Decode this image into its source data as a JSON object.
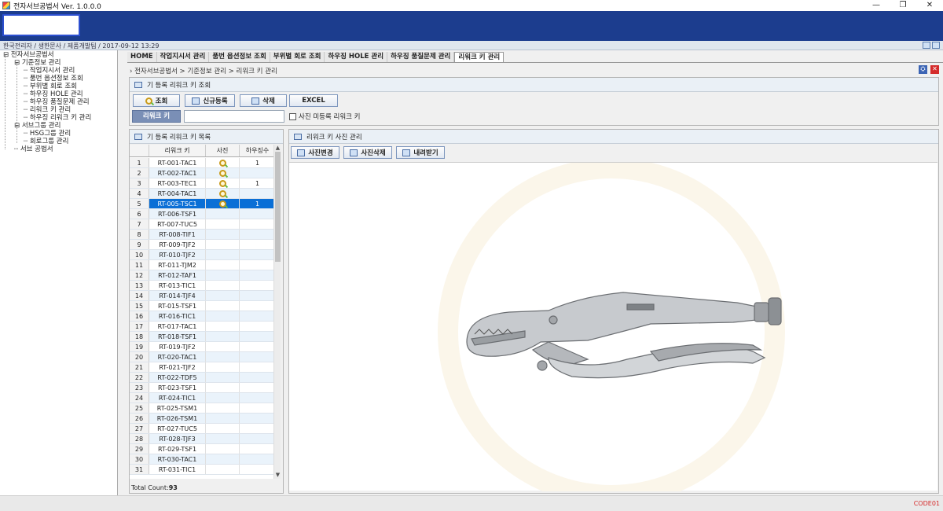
{
  "window": {
    "title": "전자서브공법서 Ver. 1.0.0.0",
    "controls": [
      "—",
      "❐",
      "✕"
    ]
  },
  "status": {
    "text": "한국전리자 / 생한문사 / 제품개발팀 / 2017-09-12 13:29"
  },
  "tree": {
    "root": "전자서브공법서",
    "groups": [
      {
        "label": "기준정보 관리",
        "items": [
          "작업지시서 관리",
          "품번 옵션정보 조회",
          "부위별 회로 조회",
          "하우징 HOLE 관리",
          "하우징 품질문제 관리",
          "리워크 키 관리",
          "하우징 리워크 키 관리"
        ]
      },
      {
        "label": "서브그룹 관리",
        "items": [
          "HSG그룹 관리",
          "회로그룹 관리"
        ]
      }
    ],
    "extra": "서브 공법서"
  },
  "tabs": [
    "HOME",
    "작업지시서 관리",
    "품번 옵션정보 조회",
    "부위별 회로 조회",
    "하우징 HOLE 관리",
    "하우징 품질문제 관리",
    "리워크 키 관리"
  ],
  "active_tab_index": 6,
  "breadcrumb": "전자서브공법서 > 기준정보 관리 > 리워크 키 관리",
  "search_panel": {
    "title": "기 등록 리워크 키 조회",
    "buttons": {
      "search": "조회",
      "new": "신규등록",
      "delete": "삭제",
      "excel": "EXCEL"
    },
    "key_label": "리워크 키",
    "key_value": "",
    "checkbox_label": "사진 미등록 리워크 키",
    "checkbox_checked": false
  },
  "list_panel": {
    "title": "기 등록 리워크 키 목록",
    "columns": [
      "",
      "리워크 키",
      "사진",
      "하우징수"
    ],
    "rows": [
      {
        "no": "1",
        "key": "RT-001-TAC1",
        "photo": true,
        "count": "1"
      },
      {
        "no": "2",
        "key": "RT-002-TAC1",
        "photo": true,
        "count": ""
      },
      {
        "no": "3",
        "key": "RT-003-TEC1",
        "photo": true,
        "count": "1"
      },
      {
        "no": "4",
        "key": "RT-004-TAC1",
        "photo": true,
        "count": ""
      },
      {
        "no": "5",
        "key": "RT-005-TSC1",
        "photo": true,
        "count": "1"
      },
      {
        "no": "6",
        "key": "RT-006-TSF1",
        "photo": false,
        "count": ""
      },
      {
        "no": "7",
        "key": "RT-007-TUC5",
        "photo": false,
        "count": ""
      },
      {
        "no": "8",
        "key": "RT-008-TIF1",
        "photo": false,
        "count": ""
      },
      {
        "no": "9",
        "key": "RT-009-TJF2",
        "photo": false,
        "count": ""
      },
      {
        "no": "10",
        "key": "RT-010-TJF2",
        "photo": false,
        "count": ""
      },
      {
        "no": "11",
        "key": "RT-011-TJM2",
        "photo": false,
        "count": ""
      },
      {
        "no": "12",
        "key": "RT-012-TAF1",
        "photo": false,
        "count": ""
      },
      {
        "no": "13",
        "key": "RT-013-TIC1",
        "photo": false,
        "count": ""
      },
      {
        "no": "14",
        "key": "RT-014-TJF4",
        "photo": false,
        "count": ""
      },
      {
        "no": "15",
        "key": "RT-015-TSF1",
        "photo": false,
        "count": ""
      },
      {
        "no": "16",
        "key": "RT-016-TIC1",
        "photo": false,
        "count": ""
      },
      {
        "no": "17",
        "key": "RT-017-TAC1",
        "photo": false,
        "count": ""
      },
      {
        "no": "18",
        "key": "RT-018-TSF1",
        "photo": false,
        "count": ""
      },
      {
        "no": "19",
        "key": "RT-019-TJF2",
        "photo": false,
        "count": ""
      },
      {
        "no": "20",
        "key": "RT-020-TAC1",
        "photo": false,
        "count": ""
      },
      {
        "no": "21",
        "key": "RT-021-TJF2",
        "photo": false,
        "count": ""
      },
      {
        "no": "22",
        "key": "RT-022-TDF5",
        "photo": false,
        "count": ""
      },
      {
        "no": "23",
        "key": "RT-023-TSF1",
        "photo": false,
        "count": ""
      },
      {
        "no": "24",
        "key": "RT-024-TIC1",
        "photo": false,
        "count": ""
      },
      {
        "no": "25",
        "key": "RT-025-TSM1",
        "photo": false,
        "count": ""
      },
      {
        "no": "26",
        "key": "RT-026-TSM1",
        "photo": false,
        "count": ""
      },
      {
        "no": "27",
        "key": "RT-027-TUC5",
        "photo": false,
        "count": ""
      },
      {
        "no": "28",
        "key": "RT-028-TJF3",
        "photo": false,
        "count": ""
      },
      {
        "no": "29",
        "key": "RT-029-TSF1",
        "photo": false,
        "count": ""
      },
      {
        "no": "30",
        "key": "RT-030-TAC1",
        "photo": false,
        "count": ""
      },
      {
        "no": "31",
        "key": "RT-031-TIC1",
        "photo": false,
        "count": ""
      }
    ],
    "selected_index": 4,
    "total_label": "Total Count:",
    "total_value": "93"
  },
  "photo_panel": {
    "title": "리워크 키 사진 관리",
    "buttons": {
      "change": "사진변경",
      "delete": "사진삭제",
      "download": "내려받기"
    }
  },
  "footer": {
    "code": "CODE01"
  },
  "colors": {
    "header": "#1c3d8e",
    "selection": "#0a6fd6",
    "row_alt": "#eaf3fb",
    "code_label": "#d62a2a"
  }
}
